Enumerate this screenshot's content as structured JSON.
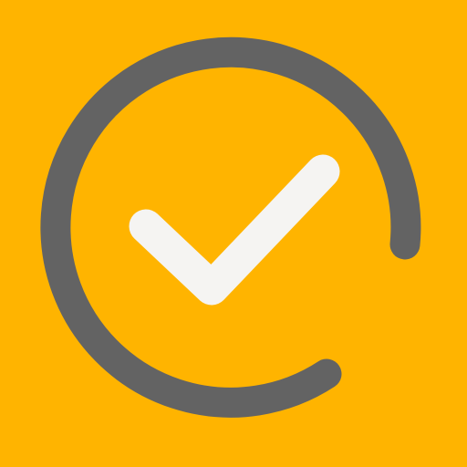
{
  "icon": {
    "name": "task-complete-app-icon",
    "glyph": "check-icon",
    "ring": "open-progress-ring",
    "colors": {
      "background": "#FFB400",
      "ring": "#636363",
      "check": "#F5F4F2"
    }
  }
}
